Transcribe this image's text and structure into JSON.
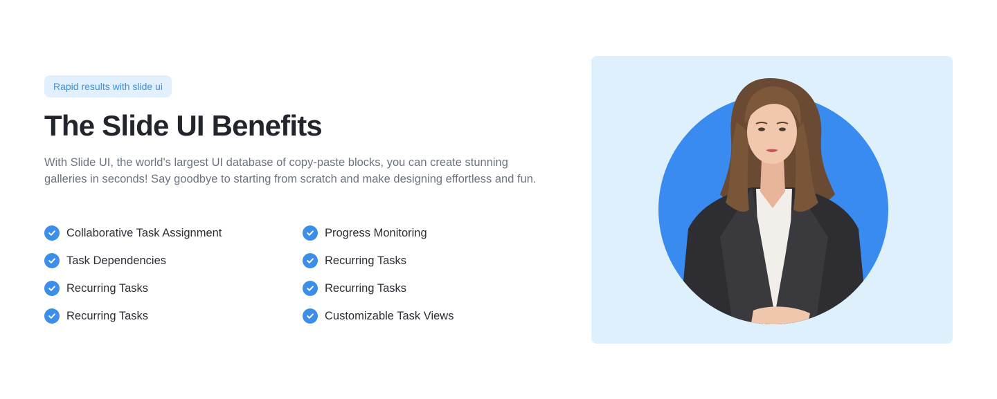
{
  "badge": "Rapid results with slide ui",
  "title": "The Slide UI Benefits",
  "description": "With Slide UI, the world's largest UI database of copy-paste blocks, you can create stunning galleries in seconds! Say goodbye to starting from scratch and make designing effortless and fun.",
  "features": [
    {
      "label": "Collaborative Task Assignment",
      "icon": "check-circle-icon"
    },
    {
      "label": "Progress Monitoring",
      "icon": "check-circle-icon"
    },
    {
      "label": "Task Dependencies",
      "icon": "check-circle-icon"
    },
    {
      "label": "Recurring Tasks",
      "icon": "check-circle-icon"
    },
    {
      "label": "Recurring Tasks",
      "icon": "check-circle-icon"
    },
    {
      "label": "Recurring Tasks",
      "icon": "check-circle-icon"
    },
    {
      "label": "Recurring Tasks",
      "icon": "check-circle-icon"
    },
    {
      "label": "Customizable Task Views",
      "icon": "check-circle-icon"
    }
  ],
  "colors": {
    "accent": "#3b8fe8",
    "badge_bg": "#e2f0fd",
    "badge_text": "#3b8fde",
    "card_bg": "#dff0fd",
    "heading": "#22252b",
    "body_text": "#6b7280"
  }
}
